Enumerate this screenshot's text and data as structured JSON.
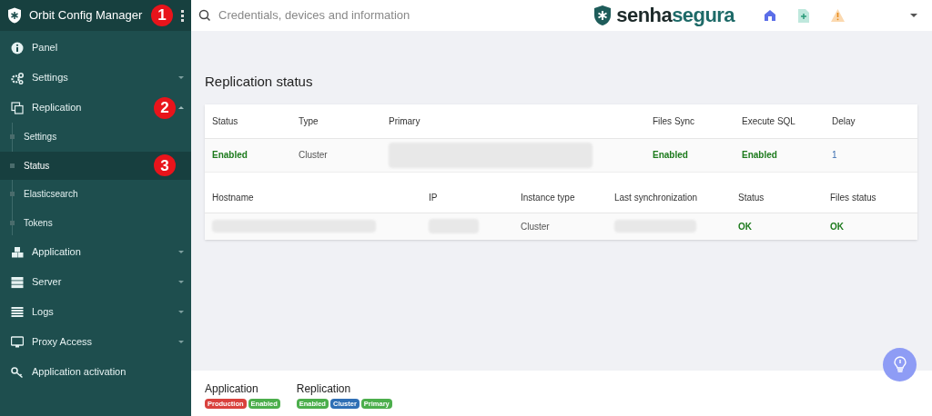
{
  "sidebar": {
    "title": "Orbit Config Manager",
    "callout": "1",
    "items": [
      {
        "kind": "link",
        "label": "Panel"
      },
      {
        "kind": "group",
        "label": "Settings",
        "expanded": false
      },
      {
        "kind": "group",
        "label": "Replication",
        "expanded": true,
        "callout": "2",
        "children": [
          {
            "label": "Settings",
            "selected": false
          },
          {
            "label": "Status",
            "selected": true,
            "callout": "3"
          },
          {
            "label": "Elasticsearch",
            "selected": false
          },
          {
            "label": "Tokens",
            "selected": false
          }
        ]
      },
      {
        "kind": "group",
        "label": "Application",
        "expanded": false
      },
      {
        "kind": "group",
        "label": "Server",
        "expanded": false
      },
      {
        "kind": "group",
        "label": "Logs",
        "expanded": false
      },
      {
        "kind": "group",
        "label": "Proxy Access",
        "expanded": false
      },
      {
        "kind": "link",
        "label": "Application activation"
      }
    ]
  },
  "search": {
    "placeholder": "Credentials, devices and information"
  },
  "brand": {
    "first": "senha",
    "second": "segura"
  },
  "page_title": "Replication status",
  "table": {
    "columns": [
      "Status",
      "Type",
      "Primary",
      "Files Sync",
      "Execute SQL",
      "Delay"
    ],
    "row": [
      {
        "kind": "status",
        "text": "Enabled"
      },
      {
        "kind": "text",
        "text": "Cluster"
      },
      {
        "kind": "redacted"
      },
      {
        "kind": "status",
        "text": "Enabled"
      },
      {
        "kind": "status",
        "text": "Enabled"
      },
      {
        "kind": "link",
        "text": "1"
      }
    ]
  },
  "instances": {
    "columns": [
      "Hostname",
      "IP",
      "Instance type",
      "Last synchronization",
      "Status",
      "Files status"
    ],
    "row": [
      {
        "kind": "redacted"
      },
      {
        "kind": "redacted"
      },
      {
        "kind": "text",
        "text": "Cluster"
      },
      {
        "kind": "redacted"
      },
      {
        "kind": "status",
        "text": "OK"
      },
      {
        "kind": "status",
        "text": "OK"
      }
    ]
  },
  "footer": [
    {
      "label": "Application",
      "badges": [
        {
          "text": "Production",
          "color": "#d9413d"
        },
        {
          "text": "Enabled",
          "color": "#4cae4c"
        }
      ]
    },
    {
      "label": "Replication",
      "badges": [
        {
          "text": "Enabled",
          "color": "#4cae4c"
        },
        {
          "text": "Cluster",
          "color": "#2f6fb5"
        },
        {
          "text": "Primary",
          "color": "#4cae4c"
        }
      ]
    }
  ]
}
